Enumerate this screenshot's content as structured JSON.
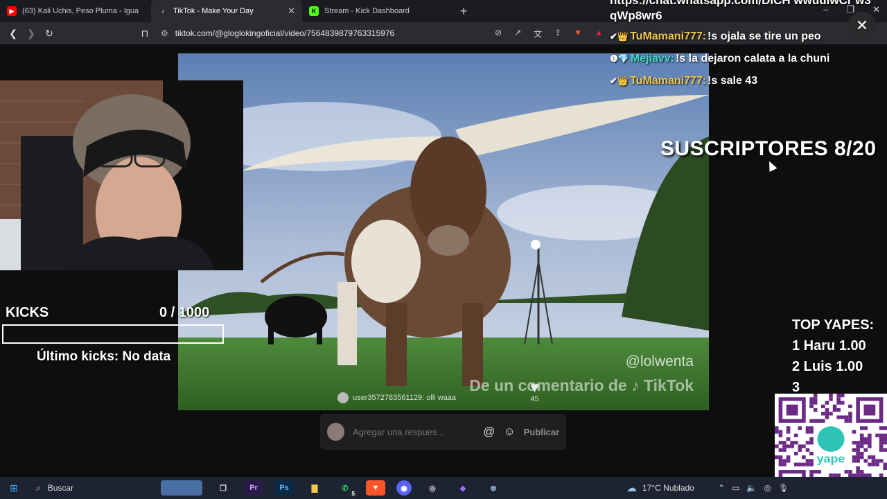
{
  "browser": {
    "tabs": [
      {
        "label": "(63) Kali Uchis, Peso Pluma - Igua",
        "fav_color": "#ff0000",
        "active": false
      },
      {
        "label": "TikTok - Make Your Day",
        "fav_color": "#ffffff",
        "active": true
      },
      {
        "label": "Stream - Kick Dashboard",
        "fav_color": "#53fc18",
        "active": false
      }
    ],
    "new_tab": "+",
    "url": "tiktok.com/@gloglokingoficial/video/7564839879763315976",
    "window_controls": [
      "–",
      "❐",
      "✕"
    ]
  },
  "video": {
    "watermark": "@lolwenta",
    "credit_text": "De un comentario de ♪ TikTok",
    "comment_user": "user3572783561129: olli waaa",
    "likes": "45"
  },
  "reply_box": {
    "placeholder": "Agregar una respues...",
    "mention_icon": "@",
    "emoji_icon": "☺",
    "publish_label": "Publicar"
  },
  "kicks": {
    "title": "KICKS",
    "count": "0  / 1000",
    "progress": 0,
    "last": "Último kicks: No data"
  },
  "chat": {
    "link_line1": "https://chat.whatsapp.com/DlCH wwuuIwCr w3",
    "link_line2": "qWp8wr6",
    "messages": [
      {
        "user": "TuMamani777:",
        "text": "!s ojala se tire un peo",
        "badge": "✔👑",
        "color": "#f2c94c"
      },
      {
        "user": "Mejiavv:",
        "text": "!s la dejaron calata a la chuni",
        "badge": "❶💎",
        "color": "#45d7c7"
      },
      {
        "user": "TuMamani777:",
        "text": "!s sale 43",
        "badge": "✔👑",
        "color": "#f2c94c"
      }
    ]
  },
  "subs": "SUSCRIPTORES 8/20",
  "yapes": {
    "title": "TOP YAPES:",
    "rows": [
      "1 Haru 1.00",
      "2 Luis 1.00",
      "3"
    ]
  },
  "qr_label": "yape",
  "taskbar": {
    "search": "Buscar",
    "weather": "17°C  Nublado",
    "whatsapp_badge": "5"
  }
}
